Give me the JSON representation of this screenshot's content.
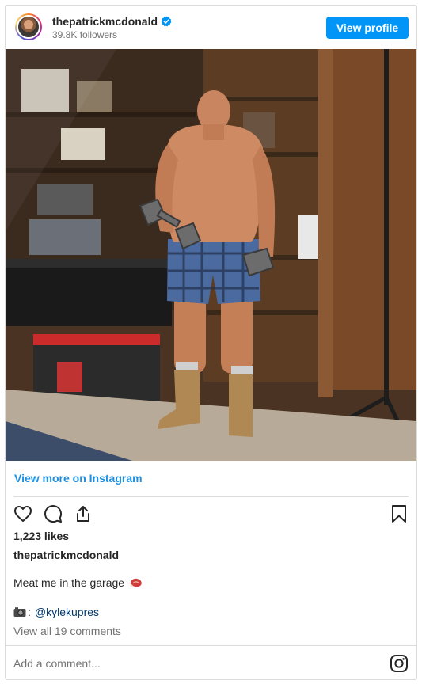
{
  "header": {
    "username": "thepatrickmcdonald",
    "followers": "39.8K followers",
    "view_profile_label": "View profile",
    "verified_icon": "verified-badge-icon"
  },
  "post": {
    "image_alt": "Shirtless man holding dumbbells in a garage",
    "view_more_label": "View more on Instagram",
    "likes": "1,223 likes",
    "caption_user": "thepatrickmcdonald",
    "caption_text": "Meat me in the garage",
    "credit_prefix": ":",
    "credit_mention": "@kylekupres",
    "view_comments": "View all 19 comments"
  },
  "comment": {
    "placeholder": "Add a comment..."
  },
  "icons": [
    "heart-icon",
    "comment-icon",
    "share-icon",
    "bookmark-icon",
    "instagram-icon",
    "camera-icon",
    "meat-icon"
  ],
  "colors": {
    "accent": "#0095f6",
    "link": "#1b8fe0",
    "mention": "#00376b",
    "muted": "#737373",
    "border": "#dbdbdb"
  }
}
